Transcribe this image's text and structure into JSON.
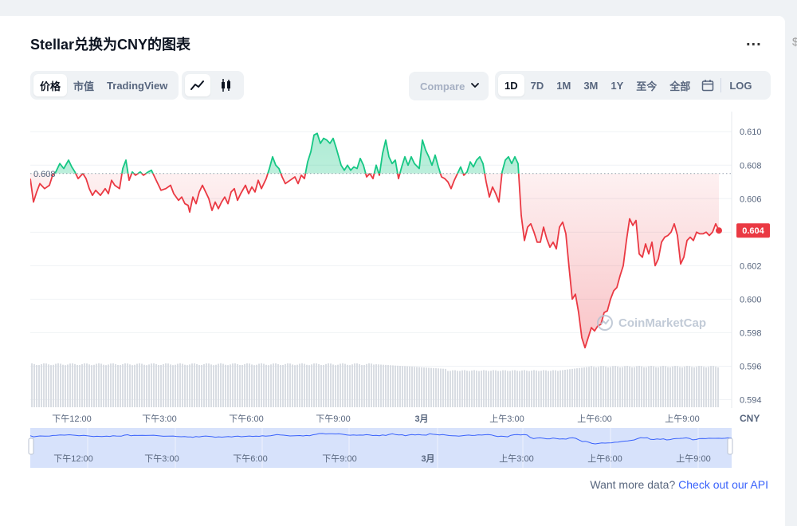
{
  "page": {
    "title": "Stellar兑换为CNY的图表",
    "more_label": "...",
    "side_glyph": "$"
  },
  "controls": {
    "metric_tabs": [
      {
        "label": "价格",
        "active": true
      },
      {
        "label": "市值",
        "active": false
      },
      {
        "label": "TradingView",
        "active": false
      }
    ],
    "chart_types": [
      {
        "icon": "line-chart-icon",
        "active": true
      },
      {
        "icon": "candlestick-icon",
        "active": false
      }
    ],
    "compare_label": "Compare",
    "ranges": [
      {
        "label": "1D",
        "active": true
      },
      {
        "label": "7D",
        "active": false
      },
      {
        "label": "1M",
        "active": false
      },
      {
        "label": "3M",
        "active": false
      },
      {
        "label": "1Y",
        "active": false
      },
      {
        "label": "至今",
        "active": false
      },
      {
        "label": "全部",
        "active": false
      }
    ],
    "calendar_icon": "calendar-icon",
    "log_label": "LOG"
  },
  "chart_data": {
    "type": "line",
    "baseline_label": "0.608",
    "baseline": 0.6075,
    "current_label": "0.604",
    "current": 0.6041,
    "unit_label": "CNY",
    "ylim": [
      0.5935,
      0.6112
    ],
    "y_ticks": [
      "0.610",
      "0.608",
      "0.606",
      "0.604",
      "0.602",
      "0.600",
      "0.598",
      "0.596",
      "0.594"
    ],
    "y_tick_values": [
      0.61,
      0.608,
      0.606,
      0.604,
      0.602,
      0.6,
      0.598,
      0.596,
      0.594
    ],
    "x_ticks": [
      "下午12:00",
      "下午3:00",
      "下午6:00",
      "下午9:00",
      "3月",
      "上午3:00",
      "上午6:00",
      "上午9:00"
    ],
    "x_tick_positions": [
      90,
      200,
      309,
      418,
      529,
      636,
      746,
      856
    ],
    "navigator_ticks": [
      "下午12:00",
      "下午3:00",
      "下午6:00",
      "下午9:00",
      "3月",
      "上午3:00",
      "上午6:00",
      "上午9:00"
    ],
    "grid": true,
    "watermark": "CoinMarketCap",
    "colors": {
      "up": "#16c784",
      "down": "#ea3943",
      "volume": "#d9dde3",
      "navigator": "#d7e2fb",
      "navigator_line": "#3861fb"
    },
    "price": [
      [
        38,
        0.6072
      ],
      [
        42,
        0.6058
      ],
      [
        46,
        0.6064
      ],
      [
        50,
        0.6069
      ],
      [
        56,
        0.6066
      ],
      [
        62,
        0.6068
      ],
      [
        66,
        0.6074
      ],
      [
        70,
        0.6076
      ],
      [
        75,
        0.6081
      ],
      [
        80,
        0.6078
      ],
      [
        86,
        0.6083
      ],
      [
        90,
        0.6079
      ],
      [
        94,
        0.6076
      ],
      [
        98,
        0.6072
      ],
      [
        104,
        0.6075
      ],
      [
        108,
        0.6072
      ],
      [
        112,
        0.6066
      ],
      [
        116,
        0.6062
      ],
      [
        120,
        0.6065
      ],
      [
        126,
        0.6062
      ],
      [
        132,
        0.6066
      ],
      [
        136,
        0.6063
      ],
      [
        140,
        0.6071
      ],
      [
        144,
        0.6068
      ],
      [
        150,
        0.6066
      ],
      [
        154,
        0.6078
      ],
      [
        158,
        0.6083
      ],
      [
        162,
        0.6071
      ],
      [
        166,
        0.6076
      ],
      [
        170,
        0.6074
      ],
      [
        176,
        0.6076
      ],
      [
        180,
        0.6074
      ],
      [
        186,
        0.6076
      ],
      [
        190,
        0.6077
      ],
      [
        196,
        0.6071
      ],
      [
        202,
        0.6065
      ],
      [
        208,
        0.6066
      ],
      [
        214,
        0.6068
      ],
      [
        218,
        0.6063
      ],
      [
        224,
        0.6059
      ],
      [
        228,
        0.6061
      ],
      [
        232,
        0.6057
      ],
      [
        236,
        0.6056
      ],
      [
        238,
        0.6052
      ],
      [
        242,
        0.6061
      ],
      [
        246,
        0.6057
      ],
      [
        250,
        0.6064
      ],
      [
        254,
        0.6068
      ],
      [
        258,
        0.6064
      ],
      [
        262,
        0.606
      ],
      [
        266,
        0.6053
      ],
      [
        270,
        0.6058
      ],
      [
        274,
        0.6054
      ],
      [
        278,
        0.6058
      ],
      [
        282,
        0.6061
      ],
      [
        286,
        0.6057
      ],
      [
        290,
        0.6064
      ],
      [
        294,
        0.6066
      ],
      [
        298,
        0.6059
      ],
      [
        302,
        0.6063
      ],
      [
        308,
        0.6068
      ],
      [
        312,
        0.6063
      ],
      [
        316,
        0.6067
      ],
      [
        320,
        0.6064
      ],
      [
        324,
        0.6071
      ],
      [
        328,
        0.6066
      ],
      [
        334,
        0.6072
      ],
      [
        338,
        0.6078
      ],
      [
        342,
        0.6085
      ],
      [
        346,
        0.608
      ],
      [
        350,
        0.6078
      ],
      [
        354,
        0.6073
      ],
      [
        358,
        0.6069
      ],
      [
        364,
        0.6071
      ],
      [
        370,
        0.6073
      ],
      [
        374,
        0.6069
      ],
      [
        378,
        0.6074
      ],
      [
        382,
        0.6072
      ],
      [
        386,
        0.6082
      ],
      [
        390,
        0.6088
      ],
      [
        394,
        0.6098
      ],
      [
        398,
        0.6099
      ],
      [
        402,
        0.6093
      ],
      [
        406,
        0.6096
      ],
      [
        410,
        0.6095
      ],
      [
        414,
        0.6093
      ],
      [
        418,
        0.6096
      ],
      [
        422,
        0.609
      ],
      [
        428,
        0.608
      ],
      [
        432,
        0.6077
      ],
      [
        436,
        0.608
      ],
      [
        440,
        0.6077
      ],
      [
        444,
        0.6079
      ],
      [
        448,
        0.6078
      ],
      [
        452,
        0.6084
      ],
      [
        456,
        0.608
      ],
      [
        460,
        0.6073
      ],
      [
        464,
        0.6075
      ],
      [
        468,
        0.6072
      ],
      [
        472,
        0.608
      ],
      [
        476,
        0.6074
      ],
      [
        480,
        0.6087
      ],
      [
        484,
        0.6095
      ],
      [
        488,
        0.6085
      ],
      [
        492,
        0.6081
      ],
      [
        496,
        0.6083
      ],
      [
        500,
        0.6072
      ],
      [
        504,
        0.6079
      ],
      [
        508,
        0.6085
      ],
      [
        512,
        0.608
      ],
      [
        516,
        0.6085
      ],
      [
        520,
        0.6081
      ],
      [
        526,
        0.6078
      ],
      [
        530,
        0.6095
      ],
      [
        534,
        0.6089
      ],
      [
        538,
        0.6085
      ],
      [
        542,
        0.608
      ],
      [
        546,
        0.6086
      ],
      [
        550,
        0.6079
      ],
      [
        554,
        0.6073
      ],
      [
        558,
        0.6072
      ],
      [
        562,
        0.607
      ],
      [
        566,
        0.6066
      ],
      [
        570,
        0.6071
      ],
      [
        574,
        0.6075
      ],
      [
        578,
        0.6079
      ],
      [
        582,
        0.6074
      ],
      [
        586,
        0.6076
      ],
      [
        590,
        0.6082
      ],
      [
        594,
        0.6079
      ],
      [
        598,
        0.6083
      ],
      [
        602,
        0.6085
      ],
      [
        606,
        0.6081
      ],
      [
        610,
        0.607
      ],
      [
        614,
        0.6061
      ],
      [
        618,
        0.6067
      ],
      [
        622,
        0.6063
      ],
      [
        626,
        0.6058
      ],
      [
        630,
        0.6076
      ],
      [
        634,
        0.6083
      ],
      [
        638,
        0.6085
      ],
      [
        642,
        0.6081
      ],
      [
        646,
        0.6085
      ],
      [
        650,
        0.6081
      ],
      [
        654,
        0.605
      ],
      [
        658,
        0.6035
      ],
      [
        662,
        0.6043
      ],
      [
        666,
        0.6045
      ],
      [
        670,
        0.604
      ],
      [
        674,
        0.6034
      ],
      [
        678,
        0.6034
      ],
      [
        682,
        0.6043
      ],
      [
        686,
        0.6036
      ],
      [
        690,
        0.6031
      ],
      [
        694,
        0.6034
      ],
      [
        698,
        0.603
      ],
      [
        702,
        0.6043
      ],
      [
        706,
        0.6046
      ],
      [
        710,
        0.6039
      ],
      [
        714,
        0.6019
      ],
      [
        718,
        0.6
      ],
      [
        722,
        0.6003
      ],
      [
        726,
        0.5992
      ],
      [
        730,
        0.5977
      ],
      [
        734,
        0.5971
      ],
      [
        738,
        0.5977
      ],
      [
        742,
        0.5983
      ],
      [
        746,
        0.5981
      ],
      [
        750,
        0.5984
      ],
      [
        754,
        0.5985
      ],
      [
        758,
        0.5992
      ],
      [
        762,
        0.5993
      ],
      [
        766,
        0.6
      ],
      [
        770,
        0.6005
      ],
      [
        774,
        0.6007
      ],
      [
        778,
        0.6014
      ],
      [
        782,
        0.602
      ],
      [
        786,
        0.6035
      ],
      [
        790,
        0.6048
      ],
      [
        794,
        0.6044
      ],
      [
        798,
        0.6047
      ],
      [
        802,
        0.6027
      ],
      [
        806,
        0.6025
      ],
      [
        810,
        0.6033
      ],
      [
        814,
        0.6027
      ],
      [
        818,
        0.6034
      ],
      [
        822,
        0.602
      ],
      [
        826,
        0.6024
      ],
      [
        830,
        0.6034
      ],
      [
        834,
        0.6037
      ],
      [
        838,
        0.6038
      ],
      [
        842,
        0.604
      ],
      [
        846,
        0.6045
      ],
      [
        850,
        0.6038
      ],
      [
        854,
        0.6021
      ],
      [
        858,
        0.6025
      ],
      [
        862,
        0.6035
      ],
      [
        866,
        0.6037
      ],
      [
        870,
        0.6035
      ],
      [
        874,
        0.604
      ],
      [
        878,
        0.6039
      ],
      [
        882,
        0.6039
      ],
      [
        886,
        0.604
      ],
      [
        890,
        0.6038
      ],
      [
        894,
        0.604
      ],
      [
        898,
        0.6045
      ],
      [
        902,
        0.6041
      ]
    ]
  },
  "footer": {
    "text": "Want more data?",
    "link": "Check out our API"
  }
}
